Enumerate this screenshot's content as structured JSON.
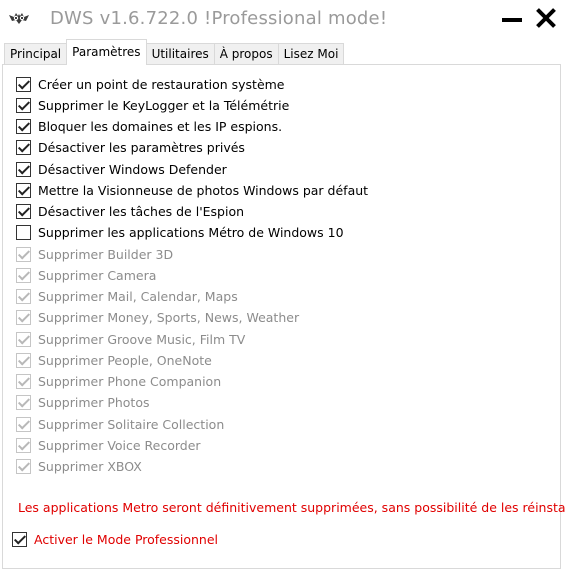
{
  "window": {
    "title": "DWS v1.6.722.0  !Professional mode!",
    "app_icon": "bat-logo-icon",
    "minimize_icon": "minimize-icon",
    "close_icon": "close-icon"
  },
  "tabs": [
    {
      "label": "Principal",
      "active": false
    },
    {
      "label": "Paramètres",
      "active": true
    },
    {
      "label": "Utilitaires",
      "active": false
    },
    {
      "label": "À propos",
      "active": false
    },
    {
      "label": "Lisez Moi",
      "active": false
    }
  ],
  "options": [
    {
      "label": "Créer un point de restauration système",
      "checked": true,
      "enabled": true
    },
    {
      "label": "Supprimer le KeyLogger et la Télémétrie",
      "checked": true,
      "enabled": true
    },
    {
      "label": "Bloquer les domaines et les IP espions.",
      "checked": true,
      "enabled": true
    },
    {
      "label": "Désactiver les paramètres privés",
      "checked": true,
      "enabled": true
    },
    {
      "label": "Désactiver Windows Defender",
      "checked": true,
      "enabled": true
    },
    {
      "label": "Mettre la Visionneuse de photos Windows par défaut",
      "checked": true,
      "enabled": true
    },
    {
      "label": "Désactiver les tâches de l'Espion",
      "checked": true,
      "enabled": true
    },
    {
      "label": "Supprimer les applications Métro de Windows 10",
      "checked": false,
      "enabled": true
    },
    {
      "label": "Supprimer Builder 3D",
      "checked": true,
      "enabled": false
    },
    {
      "label": "Supprimer Camera",
      "checked": true,
      "enabled": false
    },
    {
      "label": "Supprimer Mail, Calendar, Maps",
      "checked": true,
      "enabled": false
    },
    {
      "label": "Supprimer Money, Sports, News, Weather",
      "checked": true,
      "enabled": false
    },
    {
      "label": "Supprimer Groove Music, Film TV",
      "checked": true,
      "enabled": false
    },
    {
      "label": "Supprimer People, OneNote",
      "checked": true,
      "enabled": false
    },
    {
      "label": "Supprimer Phone Companion",
      "checked": true,
      "enabled": false
    },
    {
      "label": "Supprimer Photos",
      "checked": true,
      "enabled": false
    },
    {
      "label": "Supprimer Solitaire Collection",
      "checked": true,
      "enabled": false
    },
    {
      "label": "Supprimer Voice Recorder",
      "checked": true,
      "enabled": false
    },
    {
      "label": "Supprimer XBOX",
      "checked": true,
      "enabled": false
    }
  ],
  "warning_text": "Les applications Metro seront définitivement supprimées, sans possibilité de les réinstaller",
  "pro_mode": {
    "label": "Activer le Mode Professionnel",
    "checked": true
  },
  "colors": {
    "warning": "#e00000",
    "disabled_text": "#8c8c8c",
    "title_text": "#9a9a9a"
  }
}
